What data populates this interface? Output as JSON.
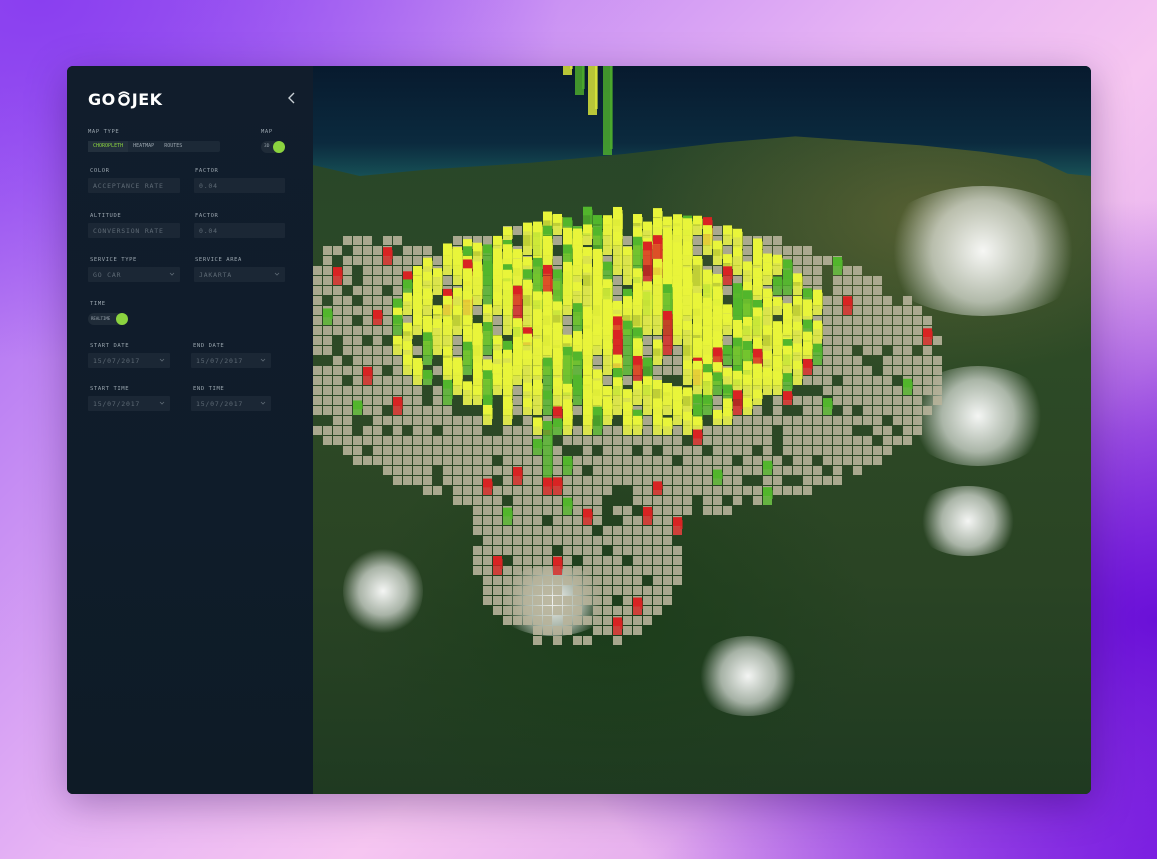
{
  "brand": {
    "logo_left": "GO",
    "logo_right": "JEK"
  },
  "sidebar": {
    "map_type_label": "MAP TYPE",
    "map_type_options": [
      "CHOROPLETH",
      "HEATMAP",
      "ROUTES"
    ],
    "map_type_selected": "CHOROPLETH",
    "map_label": "MAP",
    "map_toggle_text": "3D",
    "color_label": "COLOR",
    "color_value": "ACCEPTANCE RATE",
    "color_factor_label": "FACTOR",
    "color_factor_value": "0.04",
    "altitude_label": "ALTITUDE",
    "altitude_value": "CONVERSION RATE",
    "altitude_factor_label": "FACTOR",
    "altitude_factor_value": "0.04",
    "service_type_label": "SERVICE TYPE",
    "service_type_value": "GO CAR",
    "service_area_label": "SERVICE AREA",
    "service_area_value": "JAKARTA",
    "time_label": "TIME",
    "time_toggle_text": "REALTIME",
    "start_date_label": "START DATE",
    "start_date_value": "15/07/2017",
    "end_date_label": "END DATE",
    "end_date_value": "15/07/2017",
    "start_time_label": "START TIME",
    "start_time_value": "15/07/2017",
    "end_time_label": "END TIME",
    "end_time_value": "15/07/2017"
  },
  "colors": {
    "accent": "#8bd33f",
    "tile": "#b7b29a",
    "bar_yellow": "#e9f53a",
    "bar_green": "#52b62c",
    "bar_red": "#d92323"
  },
  "icons": {
    "collapse": "chevron-left-icon",
    "dropdown": "chevron-down-icon",
    "logo_mark": "gojek-logo-icon"
  }
}
